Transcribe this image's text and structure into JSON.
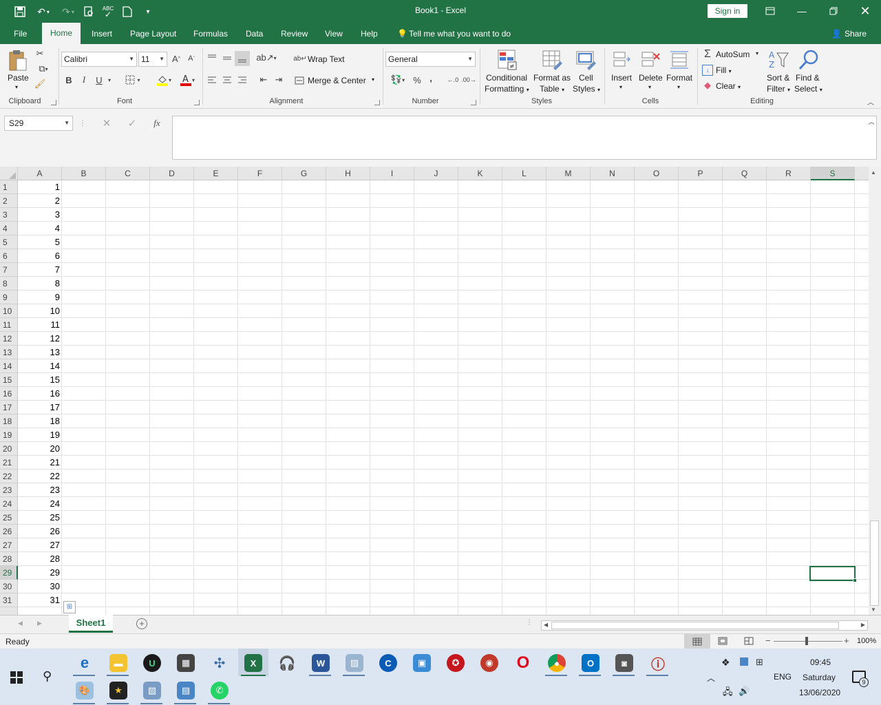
{
  "window": {
    "title": "Book1  -  Excel",
    "signin": "Sign in"
  },
  "tabs": {
    "file": "File",
    "home": "Home",
    "insert": "Insert",
    "page_layout": "Page Layout",
    "formulas": "Formulas",
    "data": "Data",
    "review": "Review",
    "view": "View",
    "help": "Help",
    "tellme": "Tell me what you want to do",
    "share": "Share"
  },
  "ribbon": {
    "clipboard": {
      "paste": "Paste",
      "label": "Clipboard"
    },
    "font": {
      "name": "Calibri",
      "size": "11",
      "bold": "B",
      "italic": "I",
      "underline": "U",
      "label": "Font"
    },
    "alignment": {
      "wrap": "Wrap Text",
      "merge": "Merge & Center",
      "label": "Alignment"
    },
    "number": {
      "format": "General",
      "percent": "%",
      "comma": ",",
      "label": "Number"
    },
    "styles": {
      "cond1": "Conditional",
      "cond2": "Formatting",
      "fmt1": "Format as",
      "fmt2": "Table",
      "cell1": "Cell",
      "cell2": "Styles",
      "label": "Styles"
    },
    "cells": {
      "insert": "Insert",
      "delete": "Delete",
      "format": "Format",
      "label": "Cells"
    },
    "editing": {
      "autosum": "AutoSum",
      "fill": "Fill",
      "clear": "Clear",
      "sort1": "Sort &",
      "sort2": "Filter",
      "find1": "Find &",
      "find2": "Select",
      "label": "Editing"
    }
  },
  "formula_bar": {
    "namebox": "S29",
    "fx": "fx",
    "value": ""
  },
  "grid": {
    "columns": [
      "A",
      "B",
      "C",
      "D",
      "E",
      "F",
      "G",
      "H",
      "I",
      "J",
      "K",
      "L",
      "M",
      "N",
      "O",
      "P",
      "Q",
      "R",
      "S"
    ],
    "selected_column": "S",
    "selected_row": 29,
    "row_numbers": [
      1,
      2,
      3,
      4,
      5,
      6,
      7,
      8,
      9,
      10,
      11,
      12,
      13,
      14,
      15,
      16,
      17,
      18,
      19,
      20,
      21,
      22,
      23,
      24,
      25,
      26,
      27,
      28,
      29,
      30,
      31
    ],
    "column_a_values": [
      1,
      2,
      3,
      4,
      5,
      6,
      7,
      8,
      9,
      10,
      11,
      12,
      13,
      14,
      15,
      16,
      17,
      18,
      19,
      20,
      21,
      22,
      23,
      24,
      25,
      26,
      27,
      28,
      29,
      30,
      31
    ]
  },
  "sheets": {
    "active": "Sheet1"
  },
  "status": {
    "text": "Ready",
    "zoom": "100%"
  },
  "taskbar": {
    "lang": "ENG",
    "time": "09:45",
    "day": "Saturday",
    "date": "13/06/2020",
    "notifications": "9"
  }
}
